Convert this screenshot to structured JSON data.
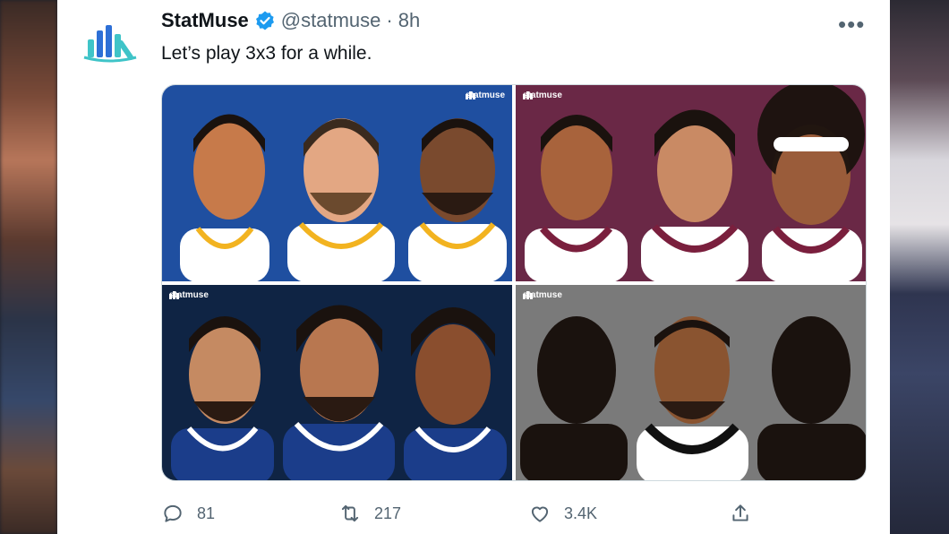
{
  "tweet": {
    "display_name": "StatMuse",
    "handle": "@statmuse",
    "separator": "·",
    "time": "8h",
    "text": "Let’s play 3x3 for a while.",
    "more_icon": "more-horizontal-icon",
    "verified_icon": "verified-badge-icon"
  },
  "media": {
    "brand_label": "statmuse",
    "tiles": [
      {
        "name": "team-tile-blue",
        "bg": "#1f4fa0",
        "jersey": "#ffffff",
        "trim": "#f2b320"
      },
      {
        "name": "team-tile-maroon",
        "bg": "#6a2846",
        "jersey": "#ffffff",
        "trim": "#7a1f3d"
      },
      {
        "name": "team-tile-navy",
        "bg": "#0f2444",
        "jersey": "#1b3d8a",
        "trim": "#ffffff"
      },
      {
        "name": "team-tile-gray",
        "bg": "#7a7a7a",
        "jersey": "#ffffff",
        "trim": "#111111"
      }
    ]
  },
  "actions": {
    "reply_count": "81",
    "retweet_count": "217",
    "like_count": "3.4K"
  },
  "colors": {
    "verified": "#1d9bf0",
    "logo_teal": "#3fc4c8",
    "logo_blue": "#2d6fd6",
    "muted_text": "#536471"
  }
}
